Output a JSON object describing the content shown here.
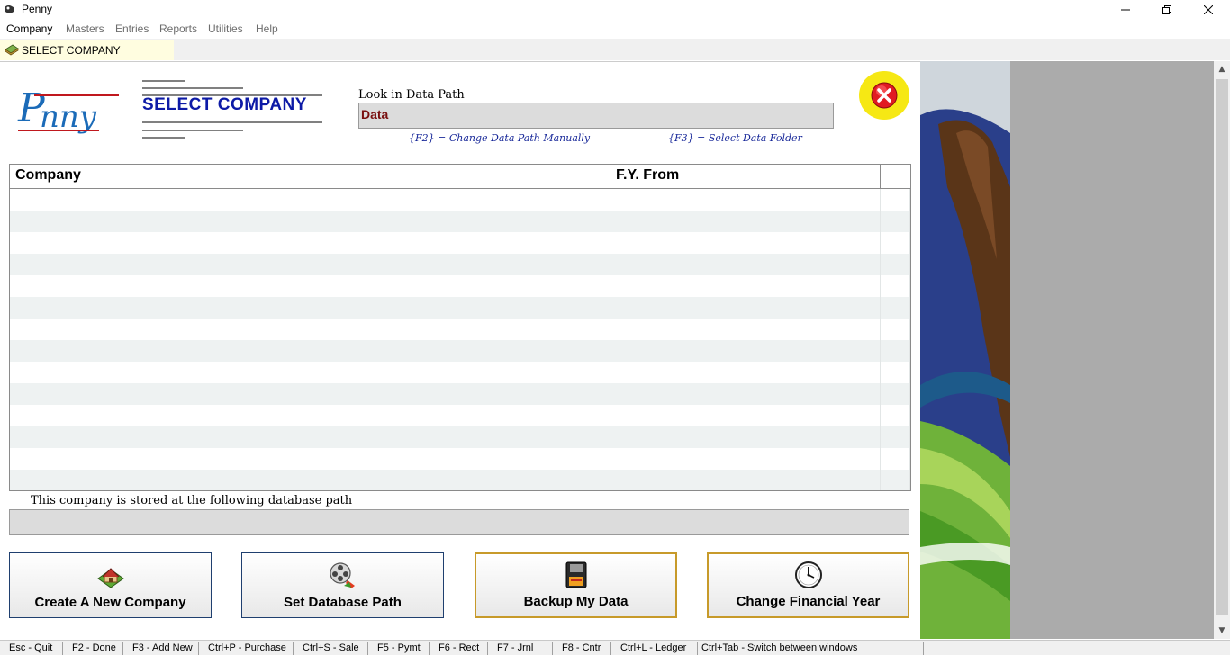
{
  "window": {
    "title": "Penny",
    "minimize_icon": "minimize-icon",
    "maximize_icon": "restore-icon",
    "close_icon": "close-icon"
  },
  "menu": {
    "items": [
      {
        "label": "Company"
      },
      {
        "label": "Masters"
      },
      {
        "label": "Entries"
      },
      {
        "label": "Reports"
      },
      {
        "label": "Utilities"
      },
      {
        "label": "Help"
      }
    ]
  },
  "tab": {
    "label": "SELECT COMPANY",
    "icon": "book-icon"
  },
  "header": {
    "logo_text": "Penny",
    "title": "SELECT COMPANY",
    "look_label": "Look in Data Path",
    "data_path": "Data",
    "hint_f2": "{F2} = Change Data Path Manually",
    "hint_f3": "{F3} = Select Data Folder"
  },
  "grid": {
    "columns": [
      "Company",
      "F.Y.  From",
      ""
    ],
    "rows": [
      [
        "",
        "",
        ""
      ],
      [
        "",
        "",
        ""
      ],
      [
        "",
        "",
        ""
      ],
      [
        "",
        "",
        ""
      ],
      [
        "",
        "",
        ""
      ],
      [
        "",
        "",
        ""
      ],
      [
        "",
        "",
        ""
      ],
      [
        "",
        "",
        ""
      ],
      [
        "",
        "",
        ""
      ],
      [
        "",
        "",
        ""
      ],
      [
        "",
        "",
        ""
      ],
      [
        "",
        "",
        ""
      ],
      [
        "",
        "",
        ""
      ],
      [
        "",
        "",
        ""
      ]
    ]
  },
  "db_path": {
    "label": "This company is stored at the following database path",
    "value": ""
  },
  "buttons": {
    "create": "Create A New Company",
    "set_path": "Set Database Path",
    "backup": "Backup My Data",
    "change_year": "Change Financial Year"
  },
  "status": {
    "items": [
      "Esc - Quit",
      "F2 - Done",
      "F3 - Add New",
      "Ctrl+P - Purchase",
      "Ctrl+S - Sale",
      "F5 - Pymt",
      "F6 - Rect",
      "F7 - Jrnl",
      "F8 - Cntr",
      "Ctrl+L - Ledger",
      "Ctrl+Tab - Switch between windows"
    ]
  },
  "colors": {
    "title_blue": "#0d1aa6",
    "path_text": "#7a1010",
    "close_yellow": "#f6e814",
    "close_red": "#e11b22",
    "row_alt": "#eef2f2"
  }
}
